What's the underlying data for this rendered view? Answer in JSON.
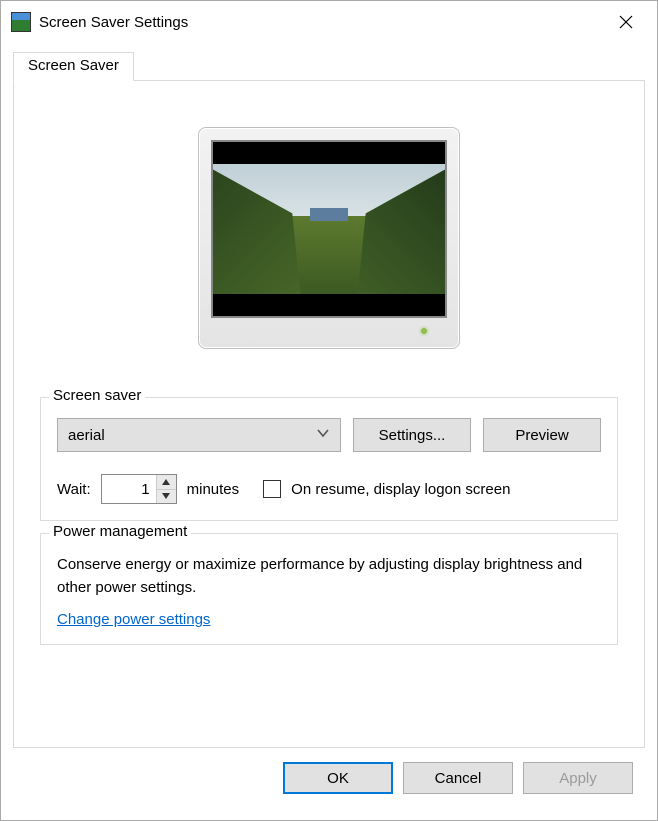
{
  "window": {
    "title": "Screen Saver Settings"
  },
  "tab": {
    "label": "Screen Saver"
  },
  "screensaver_group": {
    "legend": "Screen saver",
    "selected": "aerial",
    "settings_button": "Settings...",
    "preview_button": "Preview",
    "wait_label": "Wait:",
    "wait_value": "1",
    "minutes_label": "minutes",
    "resume_checkbox_label": "On resume, display logon screen",
    "resume_checked": false
  },
  "power_group": {
    "legend": "Power management",
    "description": "Conserve energy or maximize performance by adjusting display brightness and other power settings.",
    "link_text": "Change power settings"
  },
  "footer": {
    "ok": "OK",
    "cancel": "Cancel",
    "apply": "Apply"
  }
}
